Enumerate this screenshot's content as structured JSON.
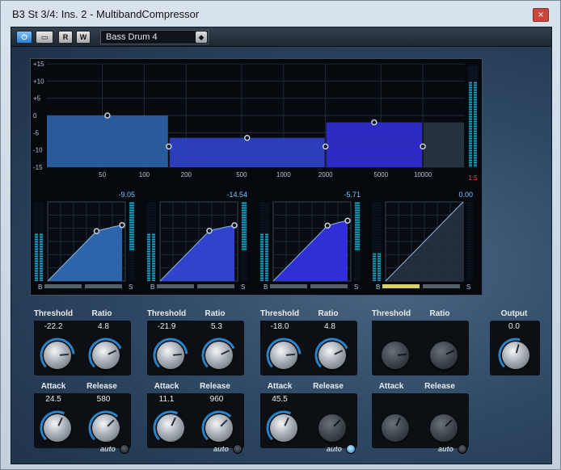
{
  "window": {
    "title": "B3 St 3/4: Ins. 2 - MultibandCompressor",
    "close_label": "×"
  },
  "toolbar": {
    "power_label": "⏻",
    "bypass_label": "▭",
    "read_label": "R",
    "write_label": "W",
    "preset_name": "Bass Drum 4",
    "preset_btn": "◆"
  },
  "display": {
    "db_ticks": [
      "+15",
      "+10",
      "+5",
      "0",
      "-5",
      "-10",
      "-15"
    ],
    "freq_ticks": [
      "50",
      "100",
      "200",
      "500",
      "1000",
      "2000",
      "5000",
      "10000"
    ],
    "sc_label": "1:5",
    "crossovers_hz": [
      150,
      2000,
      10000
    ],
    "band_gains_db": [
      0,
      -6.5,
      -2
    ],
    "band_colors": [
      "#2f69b3",
      "#3347d8",
      "#3330e0",
      "#2a3646"
    ],
    "transfer": [
      {
        "readout": "-9.05",
        "threshold": -22.2,
        "ratio": 4.8,
        "color": "#2f69b3",
        "fill": 0.38
      },
      {
        "readout": "-14.54",
        "threshold": -21.9,
        "ratio": 5.3,
        "color": "#3347d8",
        "fill": 0.38
      },
      {
        "readout": "-5.71",
        "threshold": -18.0,
        "ratio": 4.8,
        "color": "#3330e0",
        "fill": 0.38
      },
      {
        "readout": "0.00",
        "threshold": null,
        "ratio": null,
        "color": "#2a3646",
        "fill": 0.0
      }
    ],
    "b_label": "B",
    "s_label": "S"
  },
  "bands": [
    {
      "threshold_label": "Threshold",
      "ratio_label": "Ratio",
      "threshold": "-22.2",
      "ratio": "4.8",
      "attack_label": "Attack",
      "release_label": "Release",
      "attack": "24.5",
      "release": "580",
      "auto_label": "auto",
      "auto_on": false,
      "active": true
    },
    {
      "threshold_label": "Threshold",
      "ratio_label": "Ratio",
      "threshold": "-21.9",
      "ratio": "5.3",
      "attack_label": "Attack",
      "release_label": "Release",
      "attack": "11.1",
      "release": "960",
      "auto_label": "auto",
      "auto_on": false,
      "active": true
    },
    {
      "threshold_label": "Threshold",
      "ratio_label": "Ratio",
      "threshold": "-18.0",
      "ratio": "4.8",
      "attack_label": "Attack",
      "release_label": "Release",
      "attack": "45.5",
      "release": "",
      "auto_label": "auto",
      "auto_on": true,
      "active": true
    },
    {
      "threshold_label": "Threshold",
      "ratio_label": "Ratio",
      "threshold": "",
      "ratio": "",
      "attack_label": "Attack",
      "release_label": "Release",
      "attack": "",
      "release": "",
      "auto_label": "auto",
      "auto_on": false,
      "active": false
    }
  ],
  "output": {
    "label": "Output",
    "value": "0.0"
  },
  "colors": {
    "meter": "#19a5c8",
    "accent": "#2b84c9",
    "handle": "#c9d3dc",
    "gridline": "#1c2a38"
  }
}
